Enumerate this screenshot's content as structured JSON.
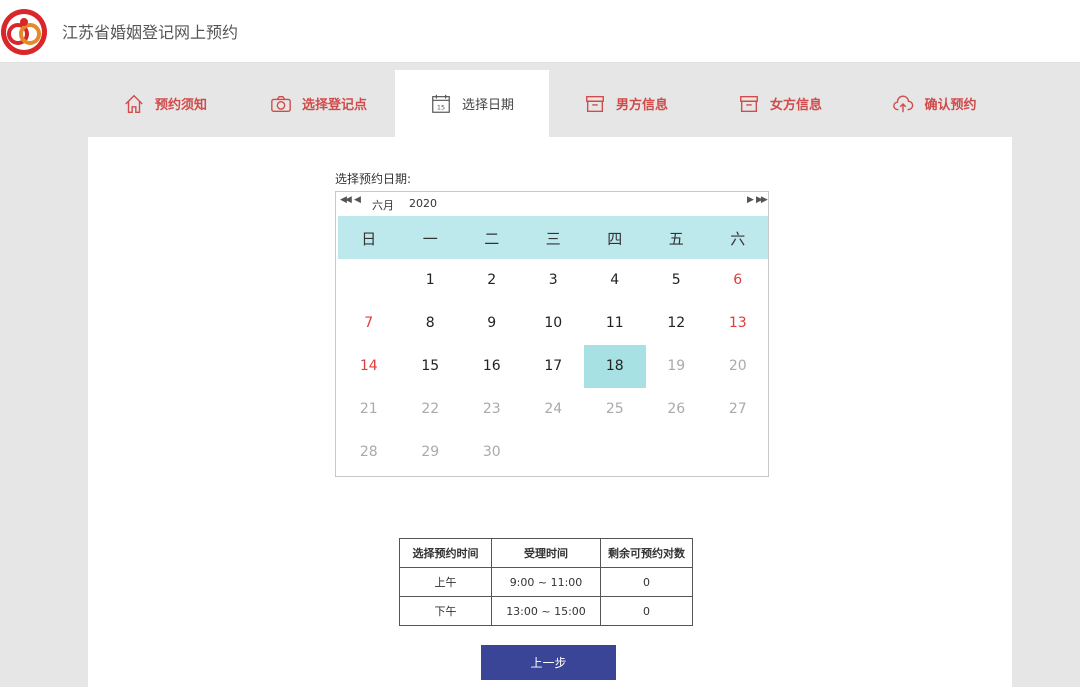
{
  "header": {
    "title": "江苏省婚姻登记网上预约"
  },
  "tabs": [
    {
      "label": "预约须知",
      "icon": "home-icon"
    },
    {
      "label": "选择登记点",
      "icon": "camera-icon"
    },
    {
      "label": "选择日期",
      "icon": "calendar-icon",
      "active": true
    },
    {
      "label": "男方信息",
      "icon": "archive-box-icon"
    },
    {
      "label": "女方信息",
      "icon": "archive-box-icon"
    },
    {
      "label": "确认预约",
      "icon": "cloud-upload-icon"
    }
  ],
  "date_picker": {
    "label": "选择预约日期:",
    "month": "六月",
    "year": "2020",
    "weekdays": [
      "日",
      "一",
      "二",
      "三",
      "四",
      "五",
      "六"
    ],
    "days": [
      "1",
      "2",
      "3",
      "4",
      "5",
      "6",
      "7",
      "8",
      "9",
      "10",
      "11",
      "12",
      "13",
      "14",
      "15",
      "16",
      "17",
      "18",
      "19",
      "20",
      "21",
      "22",
      "23",
      "24",
      "25",
      "26",
      "27",
      "28",
      "29",
      "30"
    ],
    "selected_day": "18",
    "first_weekday_index": 1,
    "enabled_through": 18
  },
  "time_table": {
    "headers": [
      "选择预约时间",
      "受理时间",
      "剩余可预约对数"
    ],
    "rows": [
      [
        "上午",
        "9:00 ~ 11:00",
        "0"
      ],
      [
        "下午",
        "13:00 ~ 15:00",
        "0"
      ]
    ]
  },
  "prev_button": {
    "label": "上一步"
  },
  "colors": {
    "accent_red": "#d24a4a",
    "weekday_header": "#bde8ec",
    "selected": "#a8e1e4",
    "button": "#3b4597"
  }
}
